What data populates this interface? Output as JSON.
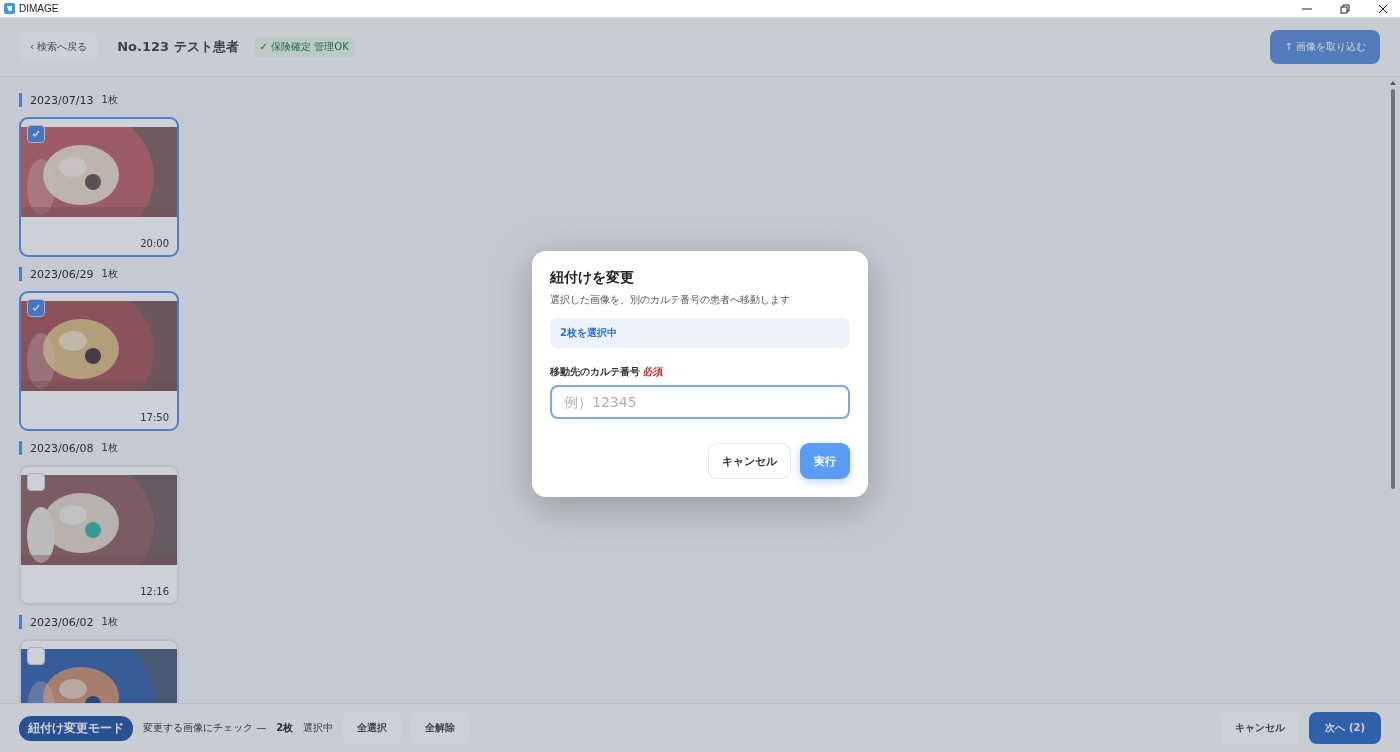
{
  "window": {
    "title": "DIMAGE"
  },
  "header": {
    "back_button": "‹ 検索へ戻る",
    "patient": "No.123  テスト患者",
    "status_badge": "✓ 保険確定 管理OK",
    "import_button": "↑ 画像を取り込む"
  },
  "groups": [
    {
      "date": "2023/07/13",
      "count": "1枚",
      "images": [
        {
          "kind": "picture",
          "time": "20:00",
          "selected": true
        }
      ]
    },
    {
      "date": "2023/06/29",
      "count": "1枚",
      "images": [
        {
          "kind": "picture",
          "time": "17:50",
          "selected": true
        }
      ]
    },
    {
      "date": "2023/06/08",
      "count": "1枚",
      "images": [
        {
          "kind": "picture",
          "time": "12:16",
          "selected": false
        }
      ]
    },
    {
      "date": "2023/06/02",
      "count": "1枚"
    }
  ],
  "footer": {
    "mode_badge": "紐付け変更モード",
    "hint": "変更する画像にチェック —",
    "selected_count": "2枚",
    "selected_label": "選択中",
    "select_all": "全選択",
    "clear_all": "全解除",
    "cancel": "キャンセル",
    "next": "次へ (2)"
  },
  "dialog": {
    "title": "紐付けを変更",
    "description": "選択した画像を、別のカルテ番号の患者へ移動します",
    "selection_info": "2枚を選択中",
    "field_label": "移動先のカルテ番号",
    "required": "必須",
    "placeholder": "例）12345",
    "cancel": "キャンセル",
    "submit": "実行"
  }
}
